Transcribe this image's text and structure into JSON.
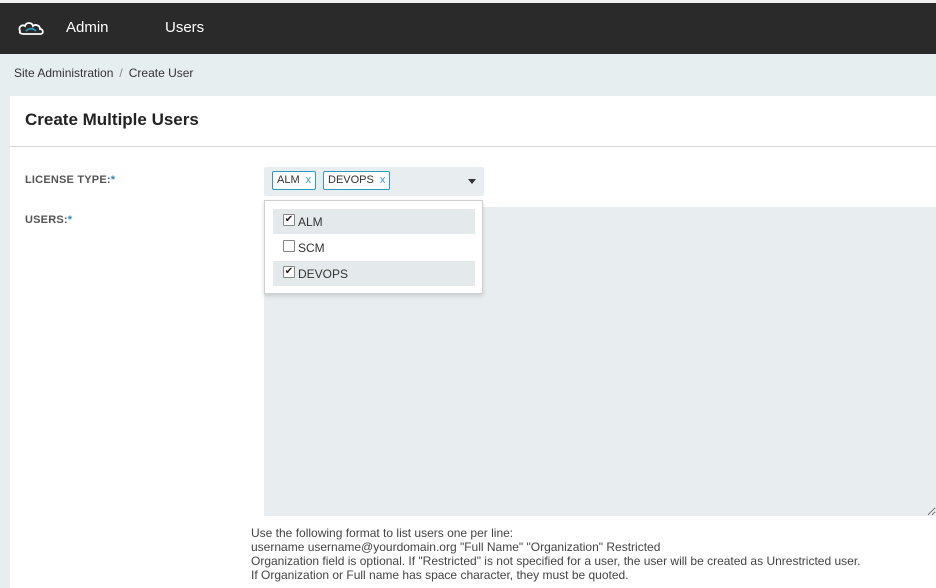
{
  "header": {
    "nav": [
      "Admin",
      "Users"
    ]
  },
  "breadcrumb": {
    "items": [
      "Site Administration",
      "Create User"
    ],
    "separator": "/"
  },
  "card": {
    "title": "Create Multiple Users"
  },
  "form": {
    "license_label": "LICENSE TYPE:",
    "users_label": "USERS:",
    "required_marker": "*",
    "selected_tags": [
      "ALM",
      "DEVOPS"
    ],
    "tag_remove": "x",
    "options": [
      {
        "label": "ALM",
        "checked": true
      },
      {
        "label": "SCM",
        "checked": false
      },
      {
        "label": "DEVOPS",
        "checked": true
      }
    ],
    "users_value": ""
  },
  "help": {
    "lines": [
      "Use the following format to list users one per line:",
      "username username@yourdomain.org \"Full Name\" \"Organization\" Restricted",
      "Organization field is optional. If \"Restricted\" is not specified for a user, the user will be created as Unrestricted user.",
      "If Organization or Full name has space character, they must be quoted."
    ]
  },
  "colors": {
    "header_bg": "#2a2a2a",
    "accent": "#2a9cc0",
    "page_bg": "#e6eef0"
  },
  "icons": {
    "logo": "cloud-logo-icon",
    "caret": "caret-down-icon",
    "check": "check-icon"
  }
}
